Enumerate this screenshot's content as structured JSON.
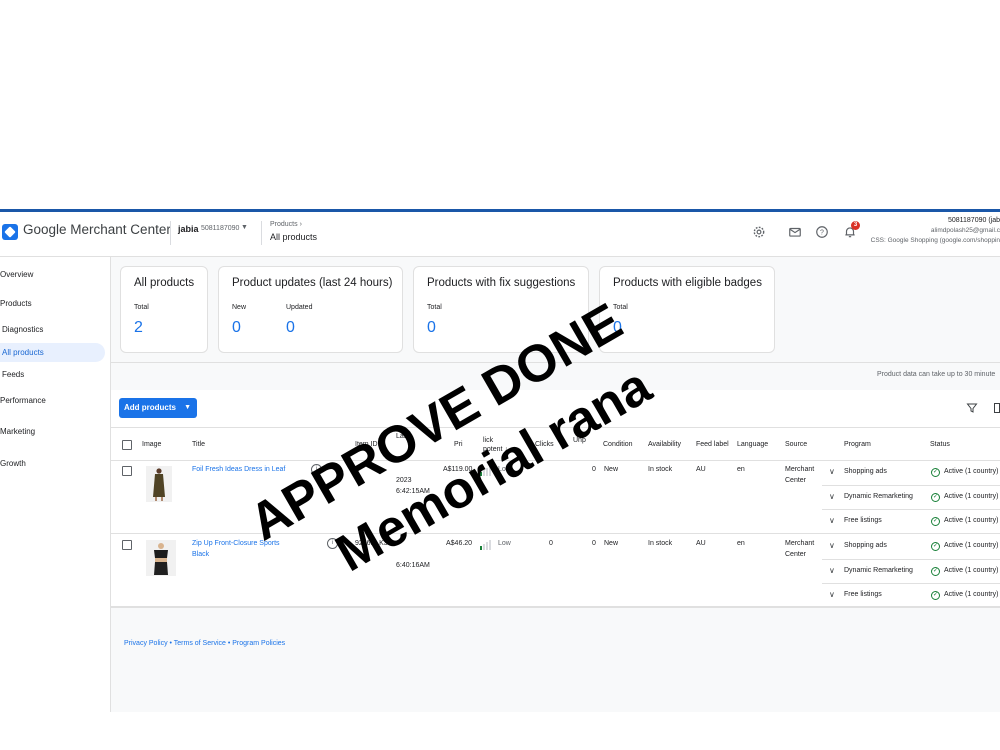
{
  "colors": {
    "brand_blue": "#1a73e8",
    "accent_dark_blue": "#1a57a8",
    "status_green": "#188038",
    "stamp_black": "#000000",
    "badge_red": "#d93025"
  },
  "header": {
    "app_title": "Google Merchant Center",
    "account_name": "jabia",
    "account_id": "5081187090",
    "breadcrumb_parent": "Products",
    "breadcrumb_current": "All products",
    "notification_count": "3",
    "user_id": "5081187090 (jab",
    "user_email": "alimdpolash25@gmail.c",
    "user_css": "CSS: Google Shopping (google.com/shoppin",
    "icons": [
      "settings-icon",
      "mail-icon",
      "help-icon",
      "bell-icon"
    ]
  },
  "sidebar": {
    "items": [
      {
        "label": "Overview"
      },
      {
        "label": "Products"
      },
      {
        "label": "Diagnostics"
      },
      {
        "label": "All products"
      },
      {
        "label": "Feeds"
      },
      {
        "label": "Performance"
      },
      {
        "label": "Marketing"
      },
      {
        "label": "Growth"
      }
    ]
  },
  "summary_cards": [
    {
      "title": "All products",
      "stats": [
        {
          "label": "Total",
          "value": "2"
        }
      ]
    },
    {
      "title": "Product updates (last 24 hours)",
      "stats": [
        {
          "label": "New",
          "value": "0"
        },
        {
          "label": "Updated",
          "value": "0"
        }
      ]
    },
    {
      "title": "Products with fix suggestions",
      "stats": [
        {
          "label": "Total",
          "value": "0"
        }
      ]
    },
    {
      "title": "Products with eligible badges",
      "stats": [
        {
          "label": "Total",
          "value": "0"
        }
      ]
    }
  ],
  "notice": "Product data can take up to 30 minute",
  "toolbar": {
    "add_products_label": "Add products"
  },
  "table": {
    "columns": [
      "Image",
      "Title",
      "Item ID",
      "Last",
      "Pri",
      "lick",
      "potent",
      "Clicks",
      "Unp",
      "Condition",
      "Availability",
      "Feed label",
      "Language",
      "Source",
      "Program",
      "Status"
    ],
    "rows": [
      {
        "title": "Foil Fresh Ideas Dress in Leaf",
        "item_id": "",
        "updated_line1": "2023",
        "updated_line2": "6:42:15AM",
        "price": "A$119.00",
        "potential": "Low",
        "potential_level": 1,
        "clicks": "",
        "unpaid": "0",
        "condition": "New",
        "availability": "In stock",
        "feed_label": "AU",
        "language": "en",
        "source_line1": "Merchant",
        "source_line2": "Center",
        "programs": [
          {
            "name": "Shopping ads",
            "status": "Active (1 country)"
          },
          {
            "name": "Dynamic Remarketing",
            "status": "Active (1 country)"
          },
          {
            "name": "Free listings",
            "status": "Active (1 country)"
          }
        ]
      },
      {
        "title_line1": "Zip Up Front-Closure Sports",
        "title_line2": "Black",
        "item_id": "9266BLK3",
        "updated_line1": "",
        "updated_line2": "6:40:16AM",
        "price": "A$46.20",
        "potential": "Low",
        "potential_level": 1,
        "clicks": "0",
        "unpaid": "0",
        "condition": "New",
        "availability": "In stock",
        "feed_label": "AU",
        "language": "en",
        "source_line1": "Merchant",
        "source_line2": "Center",
        "programs": [
          {
            "name": "Shopping ads",
            "status": "Active (1 country)"
          },
          {
            "name": "Dynamic Remarketing",
            "status": "Active (1 country)"
          },
          {
            "name": "Free listings",
            "status": "Active (1 country)"
          }
        ]
      }
    ]
  },
  "footer": {
    "links": "Privacy Policy • Terms of Service • Program Policies"
  },
  "stamp": {
    "line1": "APPROVE DONE",
    "line2": "Memorial rana"
  }
}
